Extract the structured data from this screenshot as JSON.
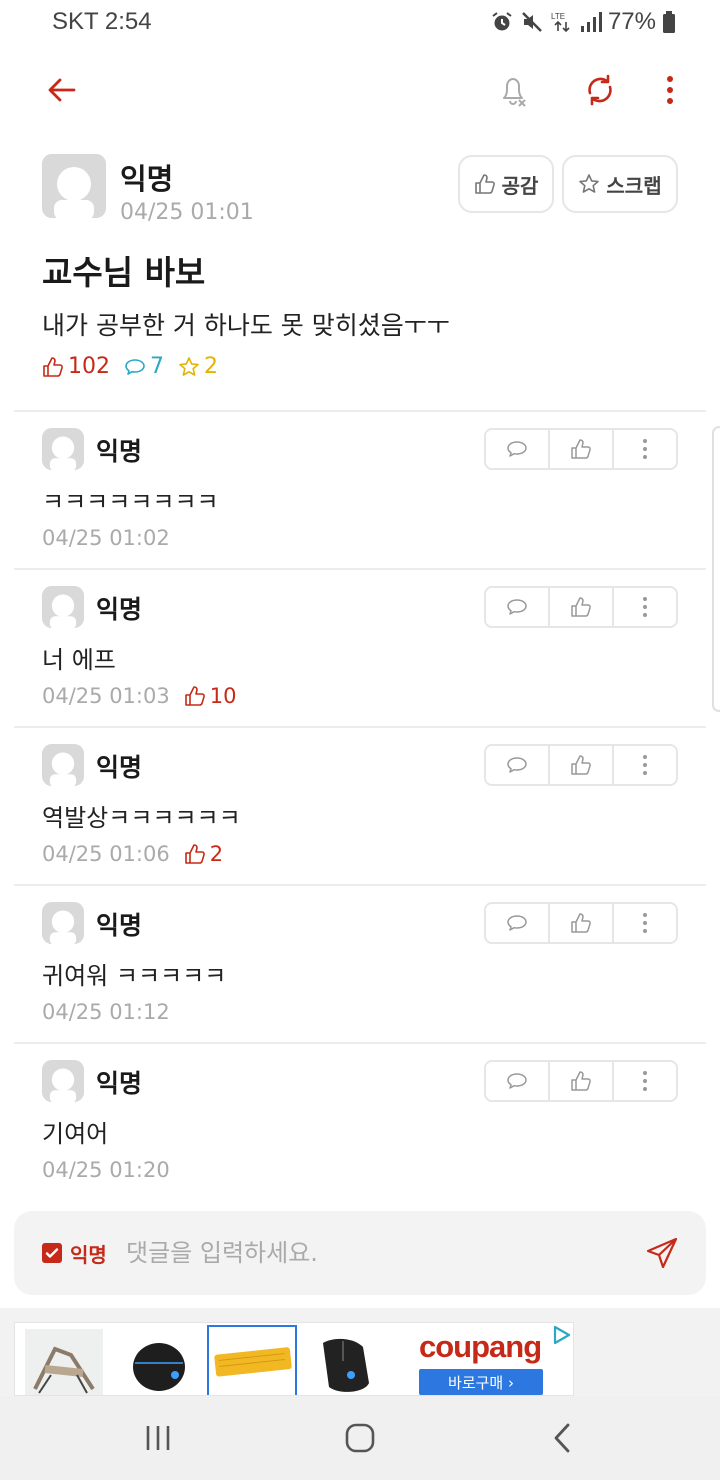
{
  "status_bar": {
    "carrier_time": "SKT 2:54",
    "battery": "77%",
    "network": "LTE"
  },
  "header": {
    "back_icon": "arrow-left-icon",
    "icons": [
      "bell-off-icon",
      "refresh-icon",
      "more-vert-icon"
    ],
    "accent": "#c62917"
  },
  "post": {
    "author": "익명",
    "time": "04/25 01:01",
    "like_button": "공감",
    "scrap_button": "스크랩",
    "title": "교수님 바보",
    "body": "내가 공부한 거 하나도 못 맞히셨음ㅜㅜ",
    "likes": "102",
    "comments": "7",
    "scraps": "2"
  },
  "comments": [
    {
      "author": "익명",
      "text": "ㅋㅋㅋㅋㅋㅋㅋㅋ",
      "time": "04/25 01:02",
      "likes": ""
    },
    {
      "author": "익명",
      "text": "너 에프",
      "time": "04/25 01:03",
      "likes": "10"
    },
    {
      "author": "익명",
      "text": "역발상ㅋㅋㅋㅋㅋㅋ",
      "time": "04/25 01:06",
      "likes": "2"
    },
    {
      "author": "익명",
      "text": "귀여워 ㅋㅋㅋㅋㅋ",
      "time": "04/25 01:12",
      "likes": ""
    },
    {
      "author": "익명",
      "text": "기여어",
      "time": "04/25 01:20",
      "likes": ""
    }
  ],
  "comment_input": {
    "anonymous_label": "익명",
    "anonymous_checked": true,
    "placeholder": "댓글을 입력하세요."
  },
  "ad": {
    "brand": "coupang",
    "cta": "바로구매 ›"
  },
  "colors": {
    "like": "#c62917",
    "comment": "#2aa8c4",
    "scrap": "#e2b400"
  }
}
